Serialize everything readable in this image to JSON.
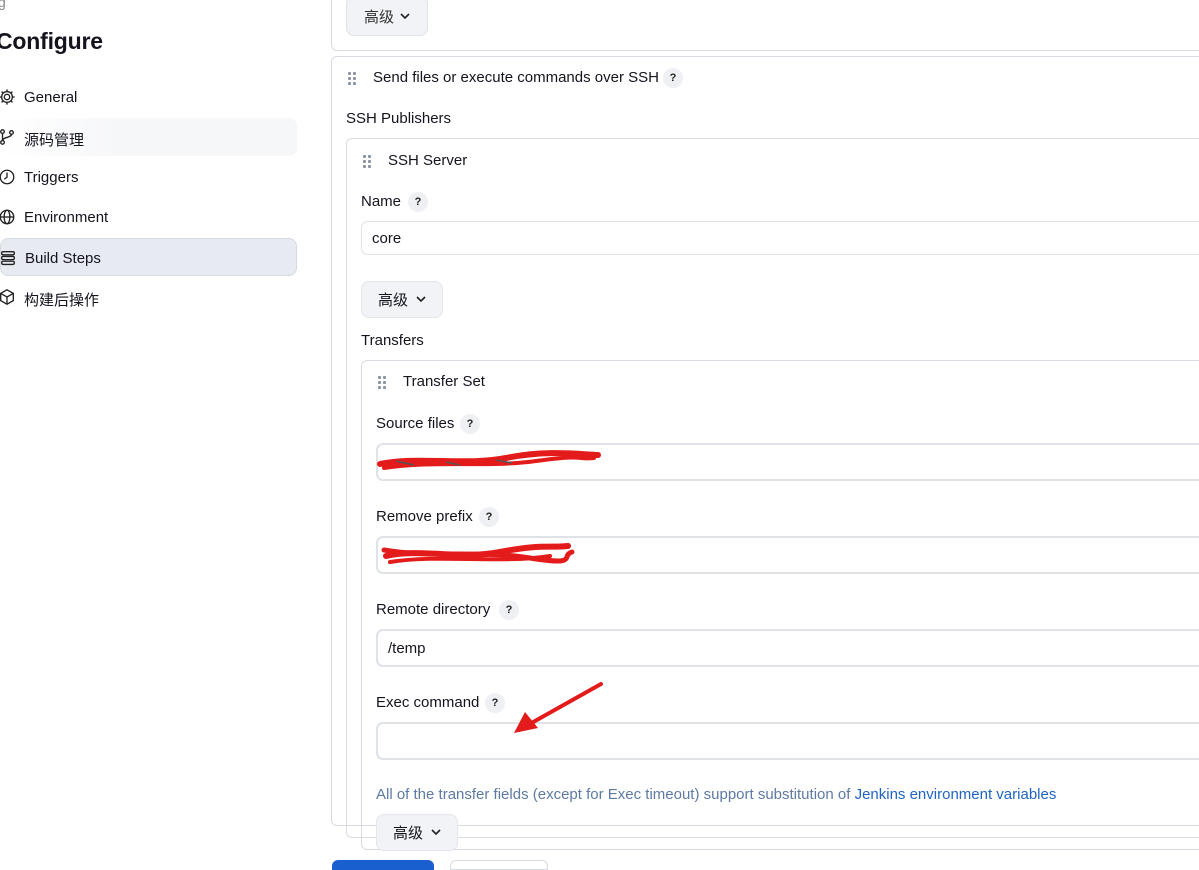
{
  "top_stub_glyph": "g",
  "page_title": "Configure",
  "sidebar": {
    "items": [
      {
        "label": "General",
        "icon": "gear-icon",
        "active": false
      },
      {
        "label": "源码管理",
        "icon": "branch-icon",
        "active": false
      },
      {
        "label": "Triggers",
        "icon": "clock-icon",
        "active": false
      },
      {
        "label": "Environment",
        "icon": "globe-icon",
        "active": false
      },
      {
        "label": "Build Steps",
        "icon": "list-icon",
        "active": true
      },
      {
        "label": "构建后操作",
        "icon": "box-icon",
        "active": false
      }
    ]
  },
  "prev_section": {
    "advanced_label": "高级"
  },
  "ssh_section": {
    "title": "Send files or execute commands over SSH",
    "help": "?",
    "publishers_label": "SSH Publishers",
    "server": {
      "title": "SSH Server",
      "name_label": "Name",
      "name_value": "core",
      "advanced_label": "高级",
      "transfers_label": "Transfers",
      "transfer_set": {
        "title": "Transfer Set",
        "source_files_label": "Source files",
        "source_files_value": "",
        "remove_prefix_label": "Remove prefix",
        "remove_prefix_value": "",
        "remote_directory_label": "Remote directory",
        "remote_directory_value": "/temp",
        "exec_command_label": "Exec command",
        "exec_command_value": "",
        "hint_text": "All of the transfer fields (except for Exec timeout) support substitution of ",
        "hint_link": "Jenkins environment variables",
        "advanced_label": "高级"
      }
    }
  },
  "colors": {
    "accent": "#1f64c4",
    "annotation_red": "#e31b1b",
    "active_nav_bg": "#e7eaf0"
  }
}
